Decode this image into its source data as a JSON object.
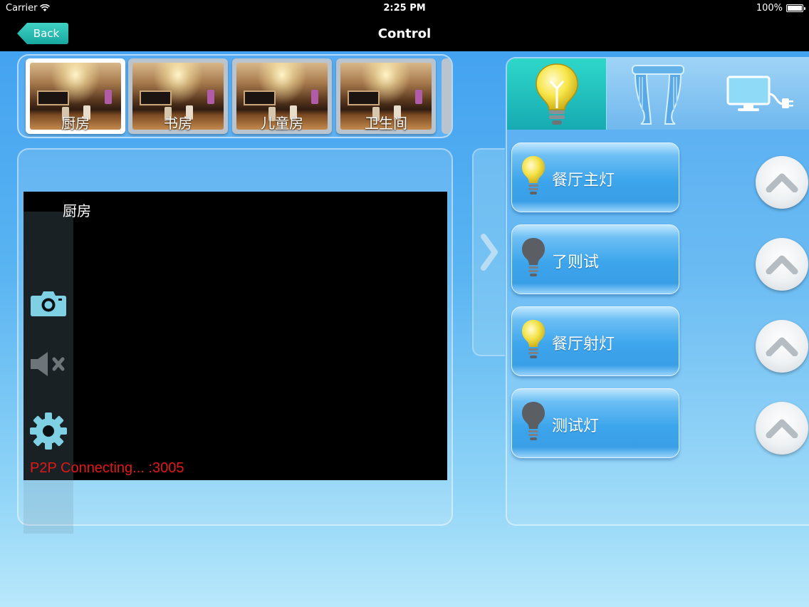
{
  "status_bar": {
    "carrier": "Carrier",
    "time": "2:25 PM",
    "battery": "100%",
    "battery_level": 1.0
  },
  "nav": {
    "back_label": "Back",
    "title": "Control"
  },
  "rooms": [
    {
      "label": "厨房",
      "selected": true
    },
    {
      "label": "书房",
      "selected": false
    },
    {
      "label": "儿童房",
      "selected": false
    },
    {
      "label": "卫生间",
      "selected": false
    }
  ],
  "video": {
    "title": "厨房",
    "status": "P2P Connecting... :3005",
    "status_color": "#e11818"
  },
  "tools": [
    {
      "icon": "camera-icon"
    },
    {
      "icon": "speaker-muted-icon"
    },
    {
      "icon": "gear-icon"
    }
  ],
  "device_tabs": [
    {
      "icon": "bulb-icon",
      "active": true
    },
    {
      "icon": "curtain-icon",
      "active": false
    },
    {
      "icon": "tv-power-icon",
      "active": false
    }
  ],
  "devices": [
    {
      "label": "餐厅主灯",
      "state": "on"
    },
    {
      "label": "了则试",
      "state": "off"
    },
    {
      "label": "餐厅射灯",
      "state": "on"
    },
    {
      "label": "测试灯",
      "state": "off"
    }
  ],
  "colors": {
    "accent_teal": "#1fb8b4",
    "bulb_on": "#f4e34a",
    "bulb_off": "#5b5f63"
  }
}
